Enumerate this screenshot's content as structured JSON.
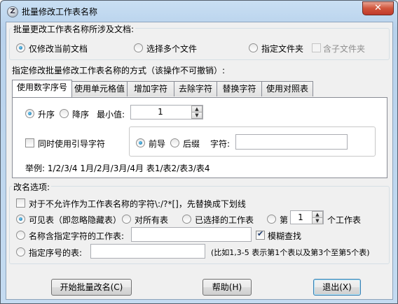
{
  "window": {
    "title": "批量修改工作表名称",
    "close_label": "✕"
  },
  "docs_group": {
    "legend": "批量更改工作表名称所涉及文档:",
    "options": [
      "仅修改当前文档",
      "选择多个文件",
      "指定文件夹"
    ],
    "selected": 0,
    "subfolder_label": "含子文件夹"
  },
  "method_label": "指定修改批量修改工作表名称的方式（该操作不可撤销）:",
  "tabs": [
    "使用数字序号",
    "使用单元格值",
    "增加字符",
    "去除字符",
    "替换字符",
    "使用对照表"
  ],
  "active_tab": 0,
  "number_tab": {
    "order_options": [
      "升序",
      "降序"
    ],
    "order_selected": 0,
    "min_label": "最小值:",
    "min_value": "1",
    "lead_char_label": "同时使用引导字符",
    "position_options": [
      "前导",
      "后缀"
    ],
    "position_selected": 0,
    "char_label": "字符:",
    "char_value": "",
    "example": "举例: 1/2/3/4 1月/2月/3月/4月 表1/表2/表3/表4"
  },
  "rename_group": {
    "legend": "改名选项:",
    "replace_invalid_label": "对于不允许作为工作表名称的字符\\:/?*[]，先替换成下划线",
    "scope_options": [
      "可见表（即忽略隐藏表）",
      "对所有表",
      "已选择的工作表",
      "第"
    ],
    "scope_selected": 0,
    "nth_value": "1",
    "nth_suffix": "个工作表",
    "name_contains_label": "名称含指定字符的工作表:",
    "name_contains_value": "",
    "fuzzy_label": "模糊查找",
    "index_label": "指定序号的表:",
    "index_value": "",
    "index_hint": "(比如1,3-5 表示第1个表以及第3个至第5个表)"
  },
  "buttons": {
    "start": "开始批量改名(C)",
    "help": "帮助(H)",
    "exit": "退出(X)"
  }
}
